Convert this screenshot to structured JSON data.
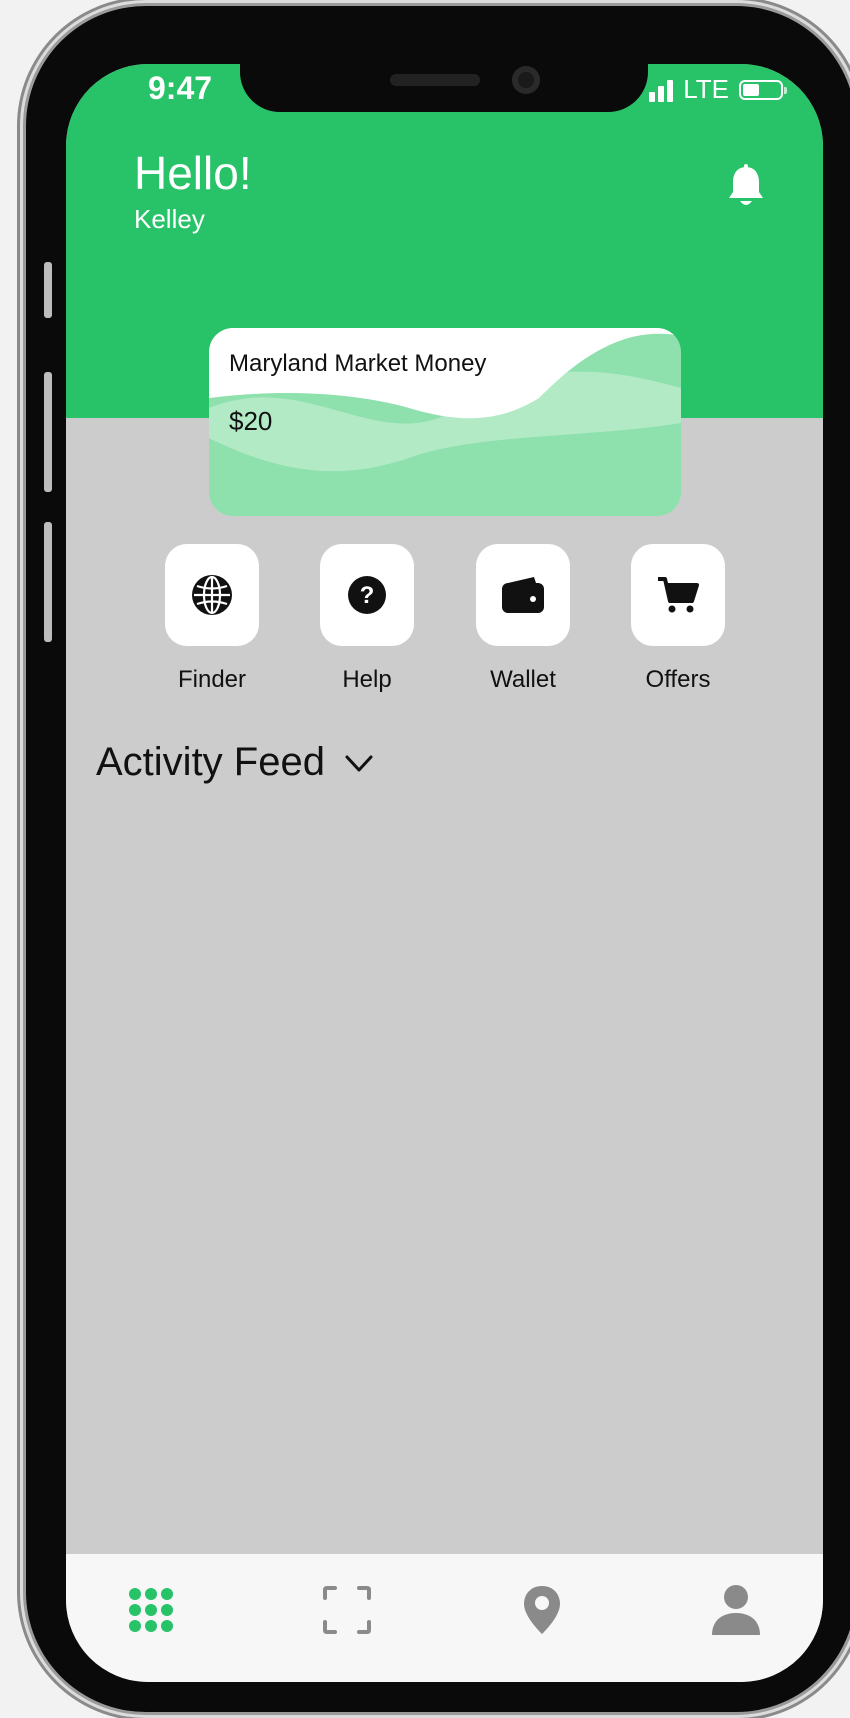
{
  "status_bar": {
    "time": "9:47",
    "network": "LTE"
  },
  "header": {
    "greeting": "Hello!",
    "user_name": "Kelley"
  },
  "card": {
    "title": "Maryland Market Money",
    "amount": "$20"
  },
  "actions": [
    {
      "label": "Finder",
      "icon": "globe-icon"
    },
    {
      "label": "Help",
      "icon": "question-icon"
    },
    {
      "label": "Wallet",
      "icon": "wallet-icon"
    },
    {
      "label": "Offers",
      "icon": "cart-icon"
    }
  ],
  "feed": {
    "title": "Activity Feed"
  },
  "tabbar": {
    "items": [
      {
        "icon": "grid-dots-icon",
        "active": true
      },
      {
        "icon": "scan-icon",
        "active": false
      },
      {
        "icon": "location-pin-icon",
        "active": false
      },
      {
        "icon": "user-icon",
        "active": false
      }
    ]
  },
  "colors": {
    "brand_green": "#28c268",
    "card_green": "#8ee0ad",
    "background": "#cccccc",
    "inactive_icon": "#8a8a8a"
  }
}
